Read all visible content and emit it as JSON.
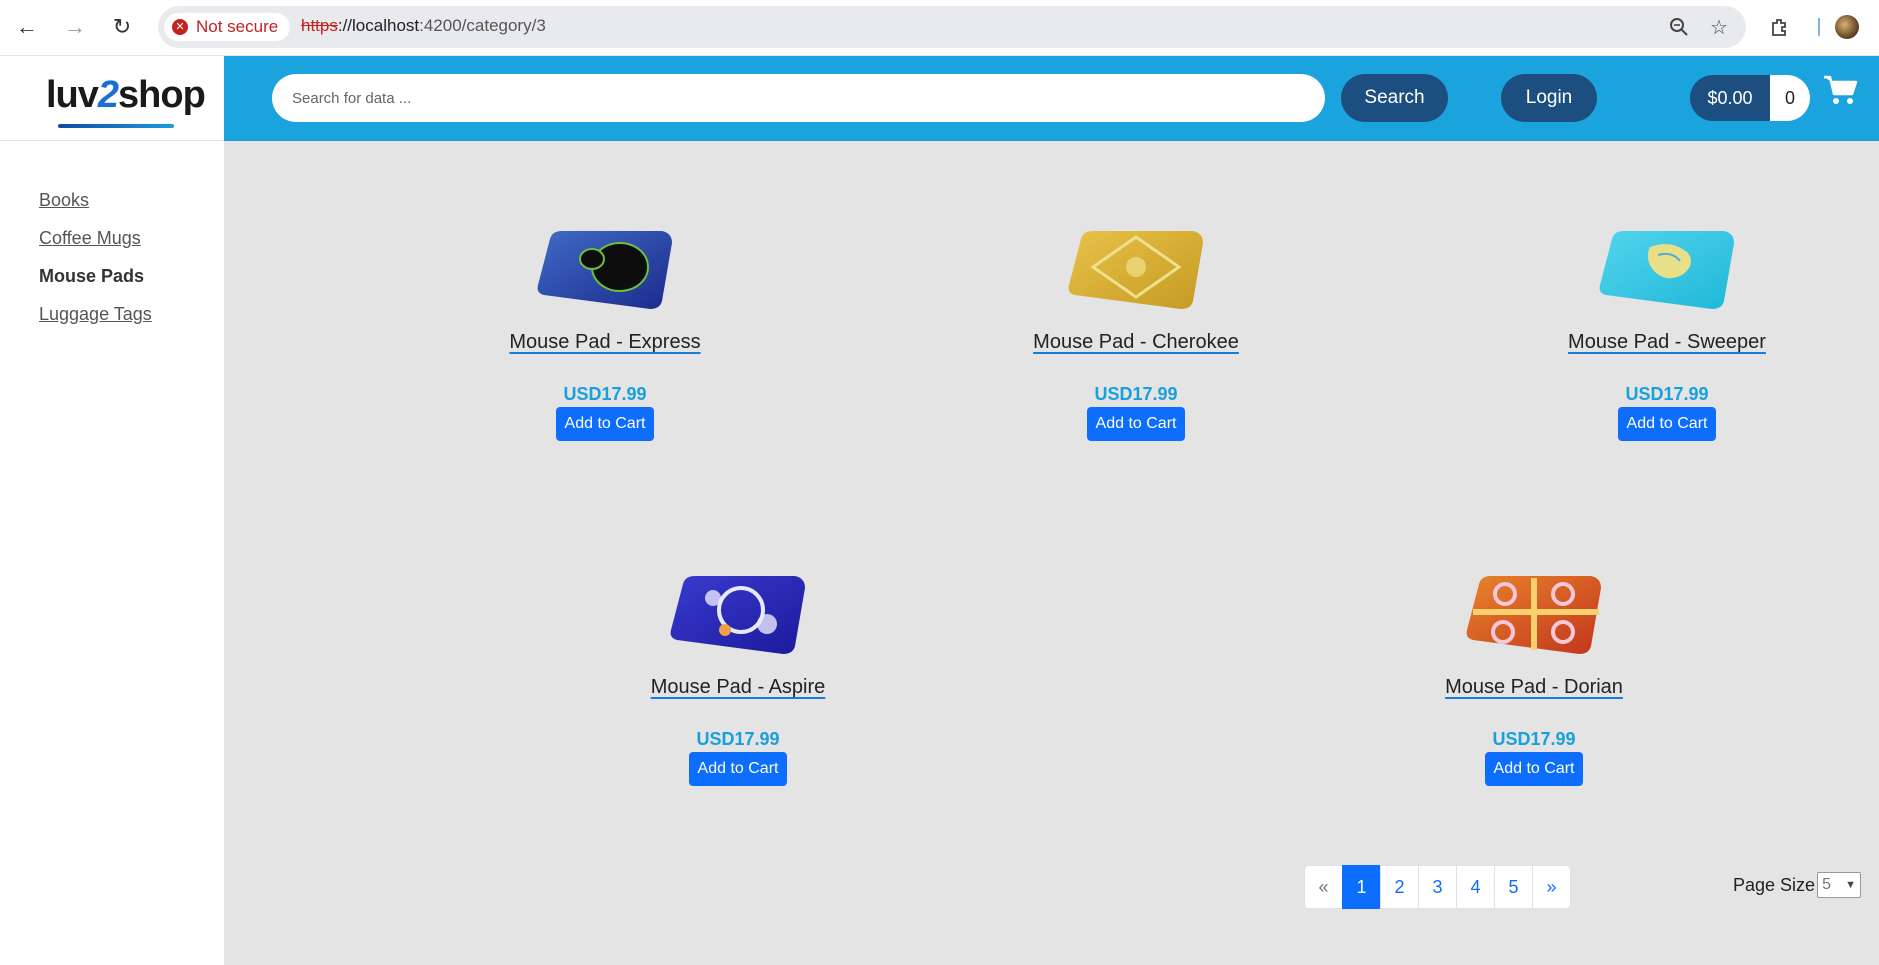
{
  "browser": {
    "security_label": "Not secure",
    "url_scheme": "https",
    "url_host": "://localhost",
    "url_path": ":4200/category/3"
  },
  "logo": {
    "part1": "luv",
    "part2": "2",
    "part3": "shop"
  },
  "header": {
    "search_placeholder": "Search for data ...",
    "search_button": "Search",
    "login_button": "Login",
    "cart_total": "$0.00",
    "cart_count": "0"
  },
  "sidebar": {
    "categories": [
      {
        "label": "Books"
      },
      {
        "label": "Coffee Mugs"
      },
      {
        "label": "Mouse Pads",
        "active": true
      },
      {
        "label": "Luggage Tags"
      }
    ]
  },
  "products": [
    {
      "name": "Mouse Pad - Express",
      "price": "USD17.99",
      "button": "Add to Cart",
      "colors": [
        "#1c2a8c",
        "#3f6ac7"
      ],
      "accent": "#0d0d0d"
    },
    {
      "name": "Mouse Pad - Cherokee",
      "price": "USD17.99",
      "button": "Add to Cart",
      "colors": [
        "#c49a22",
        "#e8c24a"
      ],
      "accent": "#f2df8a"
    },
    {
      "name": "Mouse Pad - Sweeper",
      "price": "USD17.99",
      "button": "Add to Cart",
      "colors": [
        "#1fb8d8",
        "#52d4ec"
      ],
      "accent": "#e8e089"
    },
    {
      "name": "Mouse Pad - Aspire",
      "price": "USD17.99",
      "button": "Add to Cart",
      "colors": [
        "#1a1a9a",
        "#3a3ad0"
      ],
      "accent": "#e8e8ff"
    },
    {
      "name": "Mouse Pad - Dorian",
      "price": "USD17.99",
      "button": "Add to Cart",
      "colors": [
        "#c2341e",
        "#e8842a"
      ],
      "accent": "#f7c6d8"
    }
  ],
  "pagination": {
    "prev": "«",
    "pages": [
      "1",
      "2",
      "3",
      "4",
      "5"
    ],
    "active": "1",
    "next": "»"
  },
  "page_size": {
    "label": "Page Size",
    "value": "5"
  }
}
